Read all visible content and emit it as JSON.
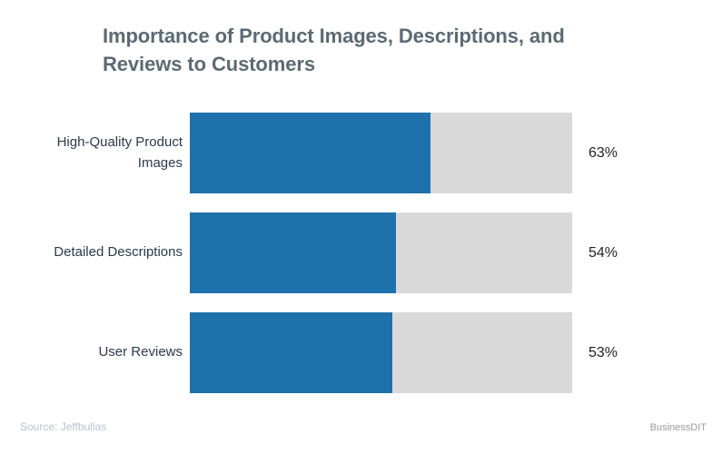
{
  "chart_data": {
    "type": "bar",
    "orientation": "horizontal",
    "title": "Importance of Product Images, Descriptions, and Reviews to Customers",
    "subtitle": "",
    "xlabel": "",
    "ylabel": "",
    "xlim": [
      0,
      100
    ],
    "grid": false,
    "legend": null,
    "categories": [
      "High-Quality Product\nImages",
      "Detailed Descriptions",
      "User Reviews"
    ],
    "values": [
      63,
      54,
      53
    ],
    "value_labels": [
      "63%",
      "54%",
      "53%"
    ],
    "track_max": 100,
    "colors": {
      "bar_fill": "#1f71ac",
      "bar_track": "#d9d9d9",
      "title_text": "#5c6a72",
      "category_text": "#2b3a4a",
      "value_text": "#231f20",
      "source_text": "#b9bfcc",
      "watermark_text": "#9a9a9a",
      "background": "#ffffff"
    }
  },
  "footer": {
    "source": "Source: Jeffbullas",
    "watermark": "BusinessDIT"
  }
}
